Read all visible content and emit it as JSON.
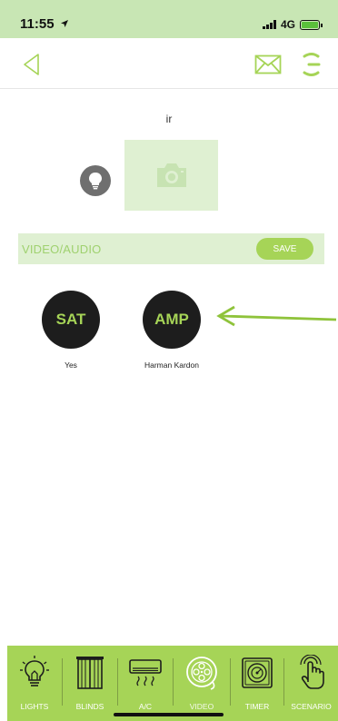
{
  "status_bar": {
    "time": "11:55",
    "network": "4G"
  },
  "header": {
    "back_icon": "back-chevron-icon",
    "mail_icon": "mail-icon",
    "menu_icon": "menu-icon"
  },
  "device": {
    "name": "ir"
  },
  "section": {
    "title": "VIDEO/AUDIO",
    "save_label": "SAVE"
  },
  "devices": [
    {
      "code": "SAT",
      "label": "Yes"
    },
    {
      "code": "AMP",
      "label": "Harman Kardon"
    }
  ],
  "tabs": [
    {
      "label": "LIGHTS",
      "icon": "bulb-icon",
      "active": false
    },
    {
      "label": "BLINDS",
      "icon": "blinds-icon",
      "active": false
    },
    {
      "label": "A/C",
      "icon": "ac-icon",
      "active": false
    },
    {
      "label": "VIDEO",
      "icon": "film-reel-icon",
      "active": true
    },
    {
      "label": "TIMER",
      "icon": "timer-icon",
      "active": false
    },
    {
      "label": "SCENARIO",
      "icon": "touch-icon",
      "active": false
    }
  ],
  "colors": {
    "accent": "#a6d457",
    "status_bar": "#c8e6b4",
    "light_green": "#dff0d2",
    "dark_circle": "#1d1d1d"
  }
}
